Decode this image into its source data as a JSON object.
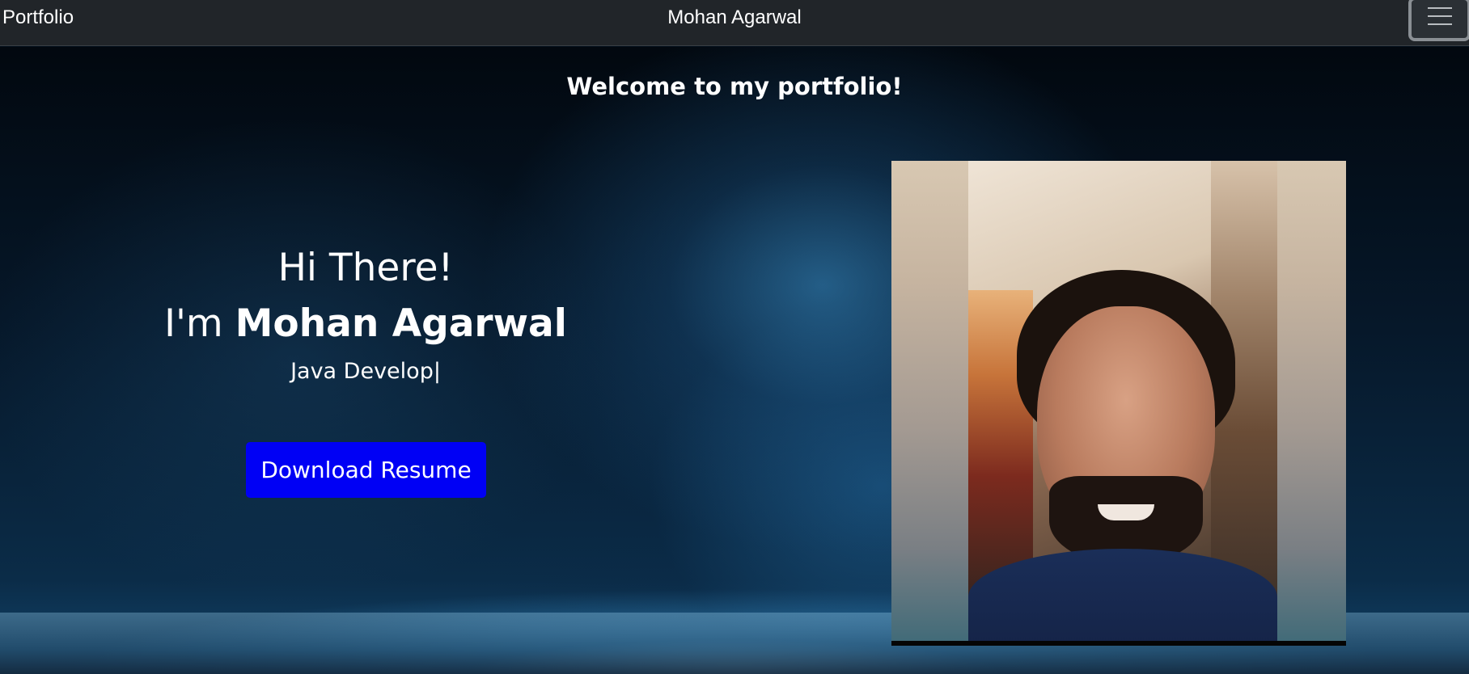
{
  "navbar": {
    "brand": "Portfolio",
    "title": "Mohan Agarwal",
    "toggler_icon": "hamburger-menu-icon"
  },
  "hero": {
    "welcome": "Welcome to my portfolio!",
    "greeting": "Hi There!",
    "intro_prefix": "I'm ",
    "name": "Mohan Agarwal",
    "role_typed": "Java Develop|",
    "download_button": "Download Resume",
    "download_button_color": "#0000f5"
  },
  "profile_photo": {
    "subject": "portrait photo of Mohan Agarwal"
  },
  "colors": {
    "navbar_bg": "#212529",
    "text": "#ffffff"
  }
}
